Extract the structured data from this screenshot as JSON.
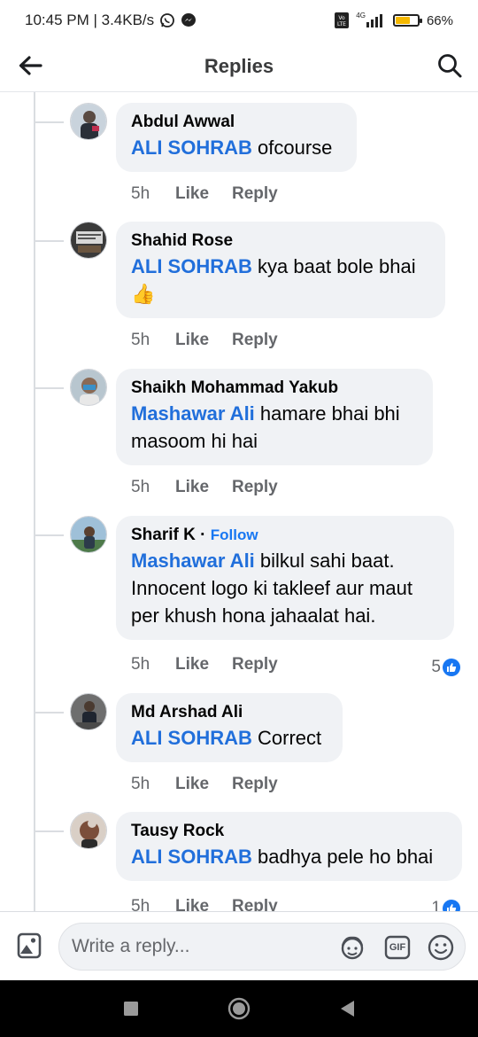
{
  "status_bar": {
    "time_speed": "10:45 PM | 3.4KB/s",
    "network": "4G",
    "battery": "66%",
    "battery_level": 0.66,
    "icons": [
      "whatsapp-icon",
      "messenger-icon",
      "volte-icon",
      "signal-icon",
      "battery-icon"
    ]
  },
  "header": {
    "title": "Replies",
    "back_icon": "arrow-left-icon",
    "search_icon": "search-icon"
  },
  "comments": [
    {
      "author": "Abdul Awwal",
      "mention": "ALI SOHRAB",
      "text": " ofcourse",
      "time": "5h",
      "like": "Like",
      "reply": "Reply"
    },
    {
      "author": "Shahid Rose",
      "mention": "ALI SOHRAB",
      "text": " kya baat bole bhai",
      "emoji": "👍",
      "time": "5h",
      "like": "Like",
      "reply": "Reply"
    },
    {
      "author": "Shaikh Mohammad Yakub",
      "mention": "Mashawar Ali",
      "text": " hamare bhai bhi masoom hi hai",
      "time": "5h",
      "like": "Like",
      "reply": "Reply"
    },
    {
      "author": "Sharif K",
      "separator": "·",
      "follow": "Follow",
      "mention": "Mashawar Ali",
      "text": " bilkul sahi baat. Innocent logo ki takleef aur maut per khush hona jahaalat hai.",
      "time": "5h",
      "like": "Like",
      "reply": "Reply",
      "reaction_count": "5"
    },
    {
      "author": "Md Arshad Ali",
      "mention": "ALI SOHRAB",
      "text": " Correct",
      "time": "5h",
      "like": "Like",
      "reply": "Reply"
    },
    {
      "author": "Tausy Rock",
      "mention": "ALI SOHRAB",
      "text": " badhya pele ho bhai",
      "time": "5h",
      "like": "Like",
      "reply": "Reply",
      "reaction_count": "1"
    }
  ],
  "composer": {
    "placeholder": "Write a reply...",
    "gif_label": "GIF",
    "icons": [
      "photo-icon",
      "avatar-sticker-icon",
      "gif-icon",
      "emoji-icon"
    ]
  },
  "colors": {
    "mention": "#216fdb",
    "bubble": "#f0f2f5",
    "meta": "#65676b",
    "accent": "#1877f2"
  }
}
